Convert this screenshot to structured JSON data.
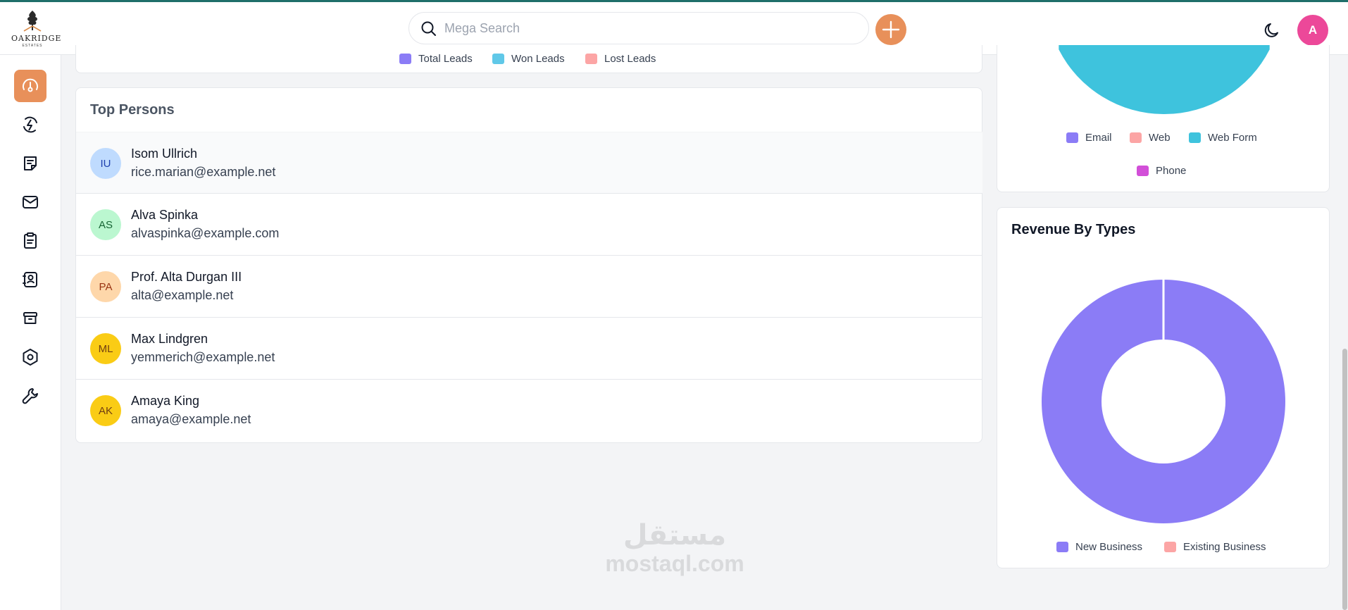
{
  "brand": {
    "name": "OAKRIDGE",
    "sub": "ESTATES"
  },
  "search": {
    "placeholder": "Mega Search"
  },
  "user": {
    "initial": "A"
  },
  "nav": [
    {
      "icon": "dashboard-icon",
      "active": true
    },
    {
      "icon": "leads-icon"
    },
    {
      "icon": "quotes-icon"
    },
    {
      "icon": "mail-icon"
    },
    {
      "icon": "activities-icon"
    },
    {
      "icon": "contacts-icon"
    },
    {
      "icon": "products-icon"
    },
    {
      "icon": "settings-icon"
    },
    {
      "icon": "configuration-icon"
    }
  ],
  "leads_legend": [
    {
      "label": "Total Leads",
      "color": "#8b7cf6"
    },
    {
      "label": "Won Leads",
      "color": "#60c8e8"
    },
    {
      "label": "Lost Leads",
      "color": "#fca5a5"
    }
  ],
  "top_persons": {
    "title": "Top Persons",
    "items": [
      {
        "initials": "IU",
        "name": "Isom Ullrich",
        "email": "rice.marian@example.net",
        "bg": "#bfdbfe",
        "fg": "#1e40af"
      },
      {
        "initials": "AS",
        "name": "Alva Spinka",
        "email": "alvaspinka@example.com",
        "bg": "#bbf7d0",
        "fg": "#166534"
      },
      {
        "initials": "PA",
        "name": "Prof. Alta Durgan III",
        "email": "alta@example.net",
        "bg": "#fed7aa",
        "fg": "#9a3412"
      },
      {
        "initials": "ML",
        "name": "Max Lindgren",
        "email": "yemmerich@example.net",
        "bg": "#facc15",
        "fg": "#713f12"
      },
      {
        "initials": "AK",
        "name": "Amaya King",
        "email": "amaya@example.net",
        "bg": "#facc15",
        "fg": "#713f12"
      }
    ]
  },
  "source_legend": [
    {
      "label": "Email",
      "color": "#8b7cf6"
    },
    {
      "label": "Web",
      "color": "#fca5a5"
    },
    {
      "label": "Web Form",
      "color": "#3ec3dd"
    },
    {
      "label": "Phone",
      "color": "#d24fd8"
    }
  ],
  "revenue": {
    "title": "Revenue By Types"
  },
  "chart_data": {
    "type": "pie",
    "title": "Revenue By Types",
    "categories": [
      "New Business",
      "Existing Business"
    ],
    "values": [
      100,
      0
    ],
    "colors": [
      "#8b7cf6",
      "#fca5a5"
    ]
  },
  "watermark": {
    "arabic": "مستقل",
    "latin": "mostaql.com"
  }
}
